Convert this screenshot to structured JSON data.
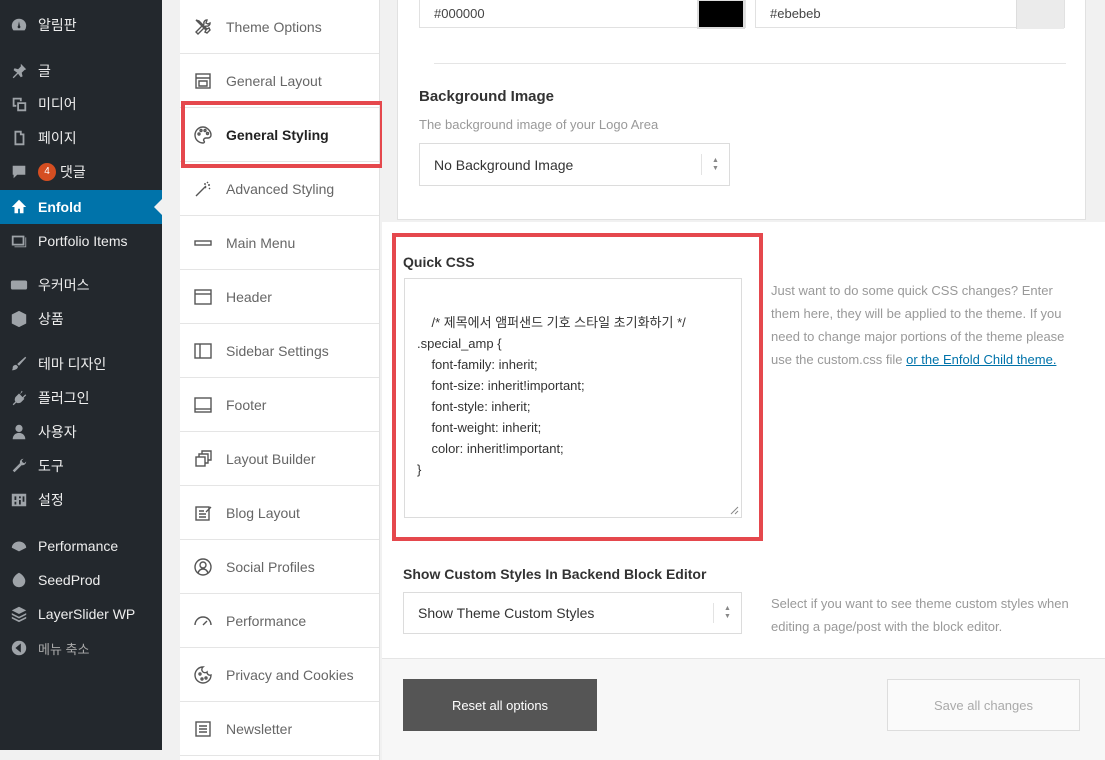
{
  "admin_menu": {
    "items": [
      {
        "label": "알림판",
        "icon": "dashboard-icon"
      },
      {
        "label": "글",
        "icon": "pin-icon"
      },
      {
        "label": "미디어",
        "icon": "media-icon"
      },
      {
        "label": "페이지",
        "icon": "page-icon"
      },
      {
        "label": "댓글",
        "icon": "comment-icon",
        "badge": "4"
      },
      {
        "label": "Enfold",
        "icon": "home-icon",
        "current": true
      },
      {
        "label": "Portfolio Items",
        "icon": "portfolio-icon"
      },
      {
        "label": "우커머스",
        "icon": "woo-icon"
      },
      {
        "label": "상품",
        "icon": "box-icon"
      },
      {
        "label": "테마 디자인",
        "icon": "brush-icon"
      },
      {
        "label": "플러그인",
        "icon": "plugin-icon"
      },
      {
        "label": "사용자",
        "icon": "user-icon"
      },
      {
        "label": "도구",
        "icon": "wrench-icon"
      },
      {
        "label": "설정",
        "icon": "settings-icon"
      },
      {
        "label": "Performance",
        "icon": "performance-icon"
      },
      {
        "label": "SeedProd",
        "icon": "seedprod-icon"
      },
      {
        "label": "LayerSlider WP",
        "icon": "layers-icon"
      },
      {
        "label": "메뉴 축소",
        "icon": "collapse-icon"
      }
    ]
  },
  "tabs": [
    {
      "label": "Theme Options",
      "icon": "tools-icon"
    },
    {
      "label": "General Layout",
      "icon": "layout-icon"
    },
    {
      "label": "General Styling",
      "icon": "palette-icon",
      "active": true
    },
    {
      "label": "Advanced Styling",
      "icon": "magic-wand-icon"
    },
    {
      "label": "Main Menu",
      "icon": "menu-bar-icon"
    },
    {
      "label": "Header",
      "icon": "header-icon"
    },
    {
      "label": "Sidebar Settings",
      "icon": "sidebar-icon"
    },
    {
      "label": "Footer",
      "icon": "footer-icon"
    },
    {
      "label": "Layout Builder",
      "icon": "layout-builder-icon"
    },
    {
      "label": "Blog Layout",
      "icon": "blog-icon"
    },
    {
      "label": "Social Profiles",
      "icon": "social-icon"
    },
    {
      "label": "Performance",
      "icon": "gauge-icon"
    },
    {
      "label": "Privacy and Cookies",
      "icon": "cookie-icon"
    },
    {
      "label": "Newsletter",
      "icon": "newsletter-icon"
    }
  ],
  "logo_area": {
    "color1": {
      "value": "#000000",
      "swatch": "#000000"
    },
    "color2": {
      "value": "#ebebeb",
      "swatch": "#ebebeb"
    },
    "background_image": {
      "title": "Background Image",
      "description": "The background image of your Logo Area",
      "selected": "No Background Image"
    }
  },
  "quick_css": {
    "title": "Quick CSS",
    "code": "/* 제목에서 앰퍼샌드 기호 스타일 초기화하기 */\n.special_amp {\n    font-family: inherit;\n    font-size: inherit!important;\n    font-style: inherit;\n    font-weight: inherit;\n    color: inherit!important;\n}",
    "description": "Just want to do some quick CSS changes? Enter them here, they will be applied to the theme. If you need to change major portions of the theme please use the custom.css file ",
    "link_text": "or the Enfold Child theme."
  },
  "backend_styles": {
    "title": "Show Custom Styles In Backend Block Editor",
    "selected": "Show Theme Custom Styles",
    "description": "Select if you want to see theme custom styles when editing a page/post with the block editor."
  },
  "buttons": {
    "reset": "Reset all options",
    "save": "Save all changes"
  },
  "colors": {
    "admin_bg": "#23282d",
    "admin_current": "#0073aa",
    "highlight": "#e5484d",
    "badge": "#d54e21"
  }
}
